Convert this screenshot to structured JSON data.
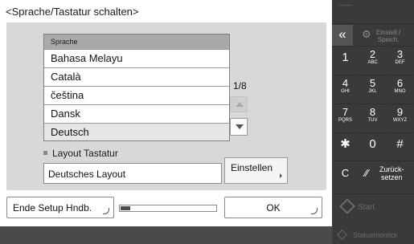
{
  "window": {
    "title": "<Sprache/Tastatur schalten>"
  },
  "language_list": {
    "header": "Sprache",
    "items": [
      "Bahasa Melayu",
      "Català",
      "čeština",
      "Dansk",
      "Deutsch"
    ],
    "selected": "Deutsch",
    "page_indicator": "1/8"
  },
  "layout": {
    "label": "Layout Tastatur",
    "value": "Deutsches Layout",
    "set_button": "Einstellen"
  },
  "footer": {
    "end_setup_button": "Ende Setup Hndb.",
    "progress": 0.1,
    "ok_button": "OK"
  },
  "keypad": {
    "status_dots": "-----",
    "back_symbol": "«",
    "settings_label": "Einstell./\nSpeich.",
    "keys": [
      {
        "digit": "1",
        "letters": ""
      },
      {
        "digit": "2",
        "letters": "ABC"
      },
      {
        "digit": "3",
        "letters": "DEF"
      },
      {
        "digit": "4",
        "letters": "GHI"
      },
      {
        "digit": "5",
        "letters": "JKL"
      },
      {
        "digit": "6",
        "letters": "MNO"
      },
      {
        "digit": "7",
        "letters": "PQRS"
      },
      {
        "digit": "8",
        "letters": "TUV"
      },
      {
        "digit": "9",
        "letters": "WXYZ"
      },
      {
        "digit": "✱",
        "letters": ""
      },
      {
        "digit": "0",
        "letters": ""
      },
      {
        "digit": "#",
        "letters": ""
      }
    ],
    "clear_label": "C",
    "reset_symbol": "⁄⁄",
    "reset_label": "Zurück-\nsetzen",
    "start_label": "Start",
    "status_monitor_label": "Statusmonitor"
  },
  "icons": {
    "back": "double-chevron-left-icon",
    "settings": "gear-icon",
    "start": "diamond-icon",
    "status_monitor": "diamond-icon"
  }
}
